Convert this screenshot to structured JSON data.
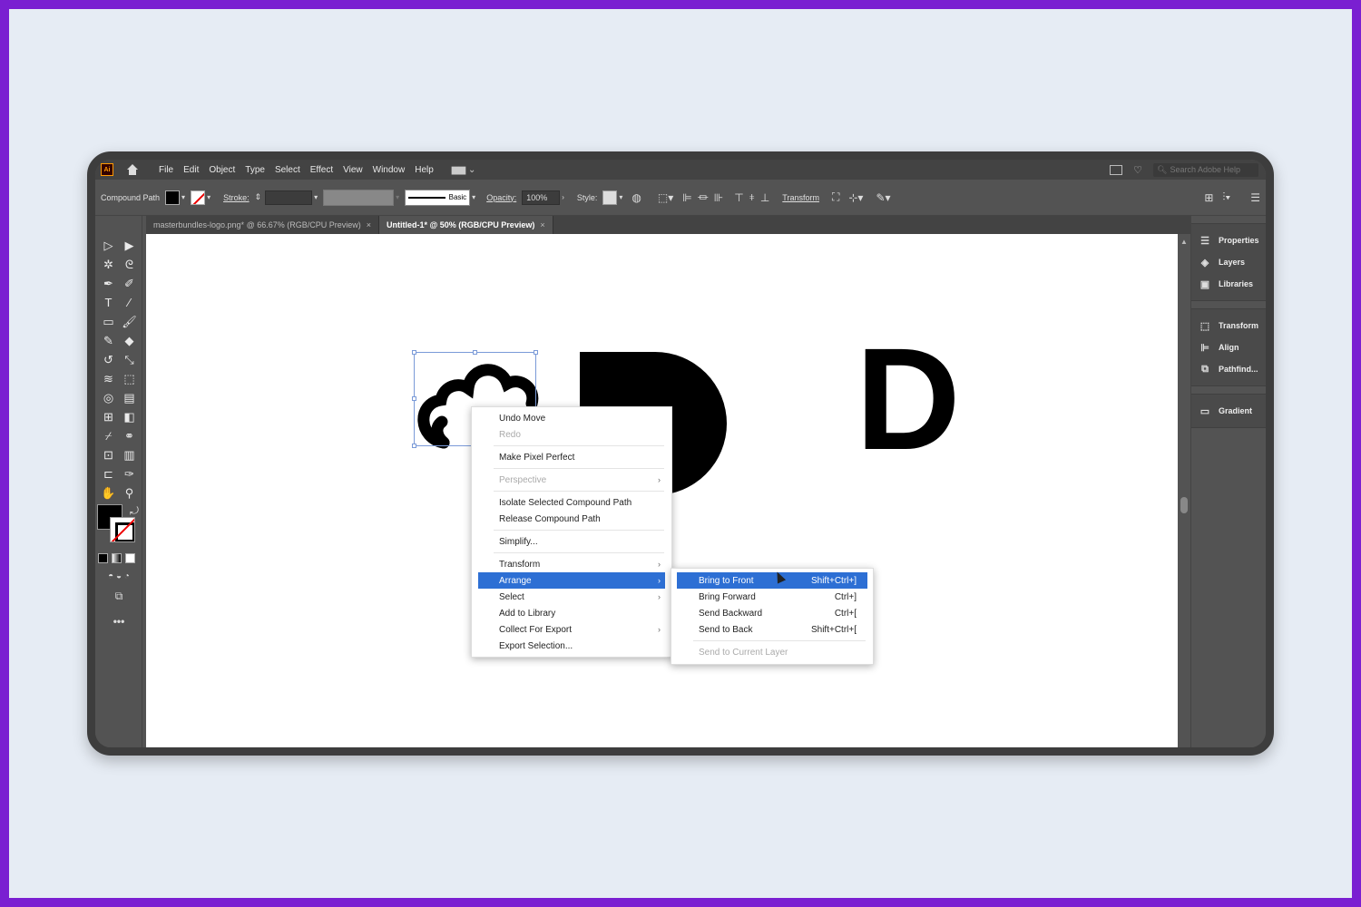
{
  "menubar": {
    "app_logo": "Ai",
    "menus": [
      "File",
      "Edit",
      "Object",
      "Type",
      "Select",
      "Effect",
      "View",
      "Window",
      "Help"
    ],
    "workspace_switcher": "▆▆ ⌄",
    "search_placeholder": "Search Adobe Help"
  },
  "controlbar": {
    "object_type": "Compound Path",
    "stroke_label": "Stroke:",
    "stroke_profile": "Basic",
    "opacity_label": "Opacity:",
    "opacity_value": "100%",
    "style_label": "Style:",
    "transform_label": "Transform"
  },
  "tabs": [
    {
      "label": "masterbundles-logo.png* @ 66.67% (RGB/CPU Preview)",
      "active": false
    },
    {
      "label": "Untitled-1* @ 50% (RGB/CPU Preview)",
      "active": true
    }
  ],
  "right_panel": {
    "group1": [
      "Properties",
      "Layers",
      "Libraries"
    ],
    "group2": [
      "Transform",
      "Align",
      "Pathfind..."
    ],
    "group3": [
      "Gradient"
    ]
  },
  "canvas": {
    "letter": "D"
  },
  "context_menu": {
    "items": [
      {
        "label": "Undo Move",
        "disabled": false,
        "submenu": false
      },
      {
        "label": "Redo",
        "disabled": true,
        "submenu": false
      },
      {
        "sep": true
      },
      {
        "label": "Make Pixel Perfect",
        "disabled": false,
        "submenu": false
      },
      {
        "sep": true
      },
      {
        "label": "Perspective",
        "disabled": true,
        "submenu": true
      },
      {
        "sep": true
      },
      {
        "label": "Isolate Selected Compound Path",
        "disabled": false,
        "submenu": false
      },
      {
        "label": "Release Compound Path",
        "disabled": false,
        "submenu": false
      },
      {
        "sep": true
      },
      {
        "label": "Simplify...",
        "disabled": false,
        "submenu": false
      },
      {
        "sep": true
      },
      {
        "label": "Transform",
        "disabled": false,
        "submenu": true
      },
      {
        "label": "Arrange",
        "disabled": false,
        "submenu": true,
        "highlight": true
      },
      {
        "label": "Select",
        "disabled": false,
        "submenu": true
      },
      {
        "label": "Add to Library",
        "disabled": false,
        "submenu": false
      },
      {
        "label": "Collect For Export",
        "disabled": false,
        "submenu": true
      },
      {
        "label": "Export Selection...",
        "disabled": false,
        "submenu": false
      }
    ]
  },
  "arrange_submenu": {
    "items": [
      {
        "label": "Bring to Front",
        "shortcut": "Shift+Ctrl+]",
        "highlight": true
      },
      {
        "label": "Bring Forward",
        "shortcut": "Ctrl+]"
      },
      {
        "label": "Send Backward",
        "shortcut": "Ctrl+["
      },
      {
        "label": "Send to Back",
        "shortcut": "Shift+Ctrl+["
      },
      {
        "sep": true
      },
      {
        "label": "Send to Current Layer",
        "shortcut": "",
        "disabled": true
      }
    ]
  },
  "colors": {
    "highlight": "#2d6fd4",
    "annotation_arrow": "#ff5a1f",
    "frame": "#7a1fd1"
  }
}
